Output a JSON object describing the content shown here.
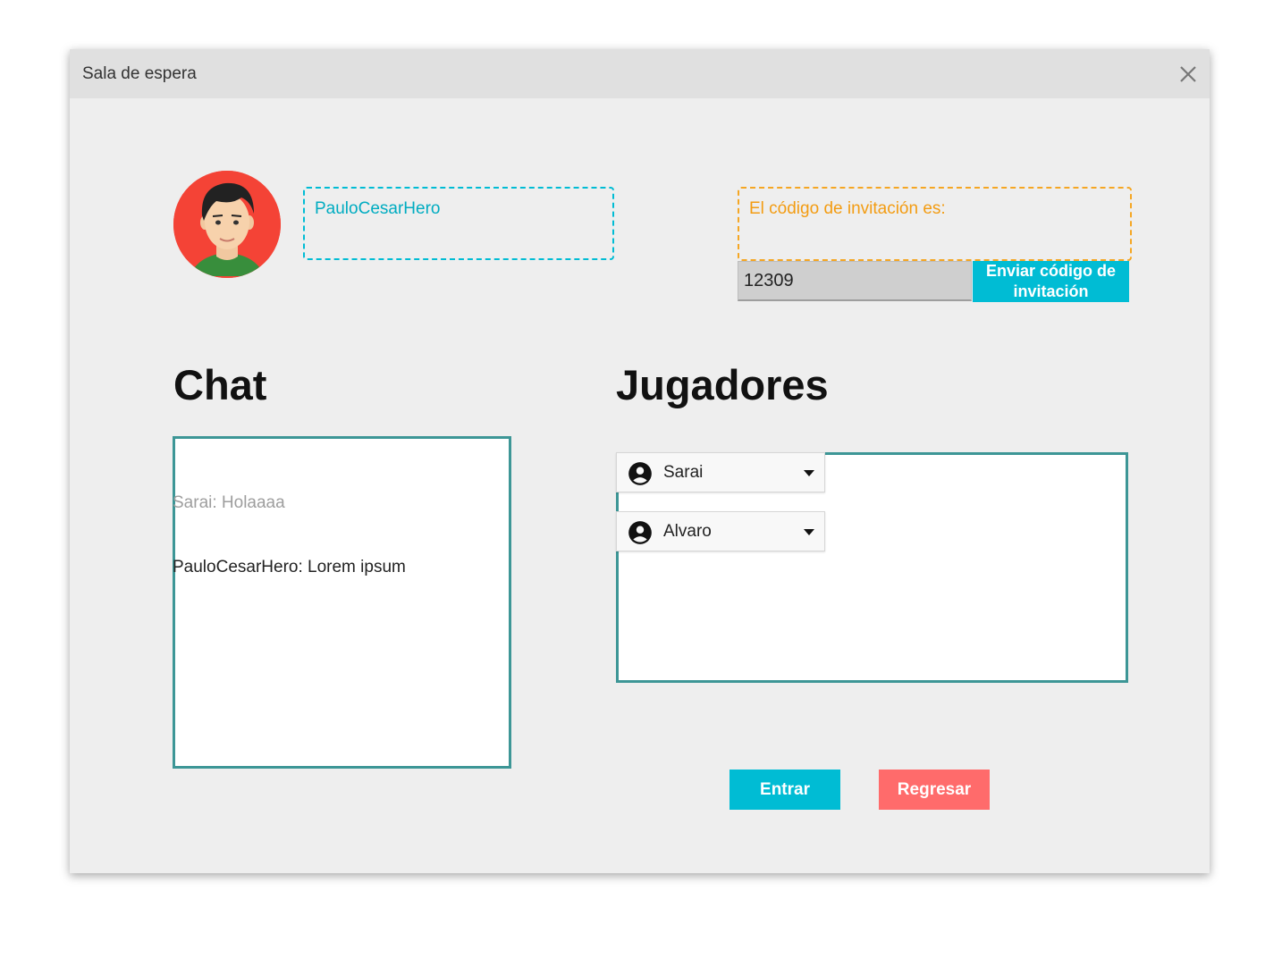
{
  "window": {
    "title": "Sala de espera"
  },
  "user": {
    "username": "PauloCesarHero"
  },
  "invite": {
    "label": "El código de invitación es:",
    "code": "12309",
    "send_button": "Enviar código de invitación"
  },
  "chat": {
    "heading": "Chat",
    "messages": [
      {
        "text": "Sarai: Holaaaa",
        "color": "#9e9e9e"
      },
      {
        "text": "PauloCesarHero: Lorem ipsum",
        "color": "#222222"
      }
    ]
  },
  "players": {
    "heading": "Jugadores",
    "list": [
      {
        "name": "Sarai",
        "icon": "account-circle-icon"
      },
      {
        "name": "Alvaro",
        "icon": "account-circle-icon"
      }
    ]
  },
  "actions": {
    "enter": "Entrar",
    "back": "Regresar"
  },
  "colors": {
    "primary": "#00bcd4",
    "danger": "#ff6b6b",
    "invite_border": "#f5a623",
    "panel_border": "#3d9696"
  }
}
